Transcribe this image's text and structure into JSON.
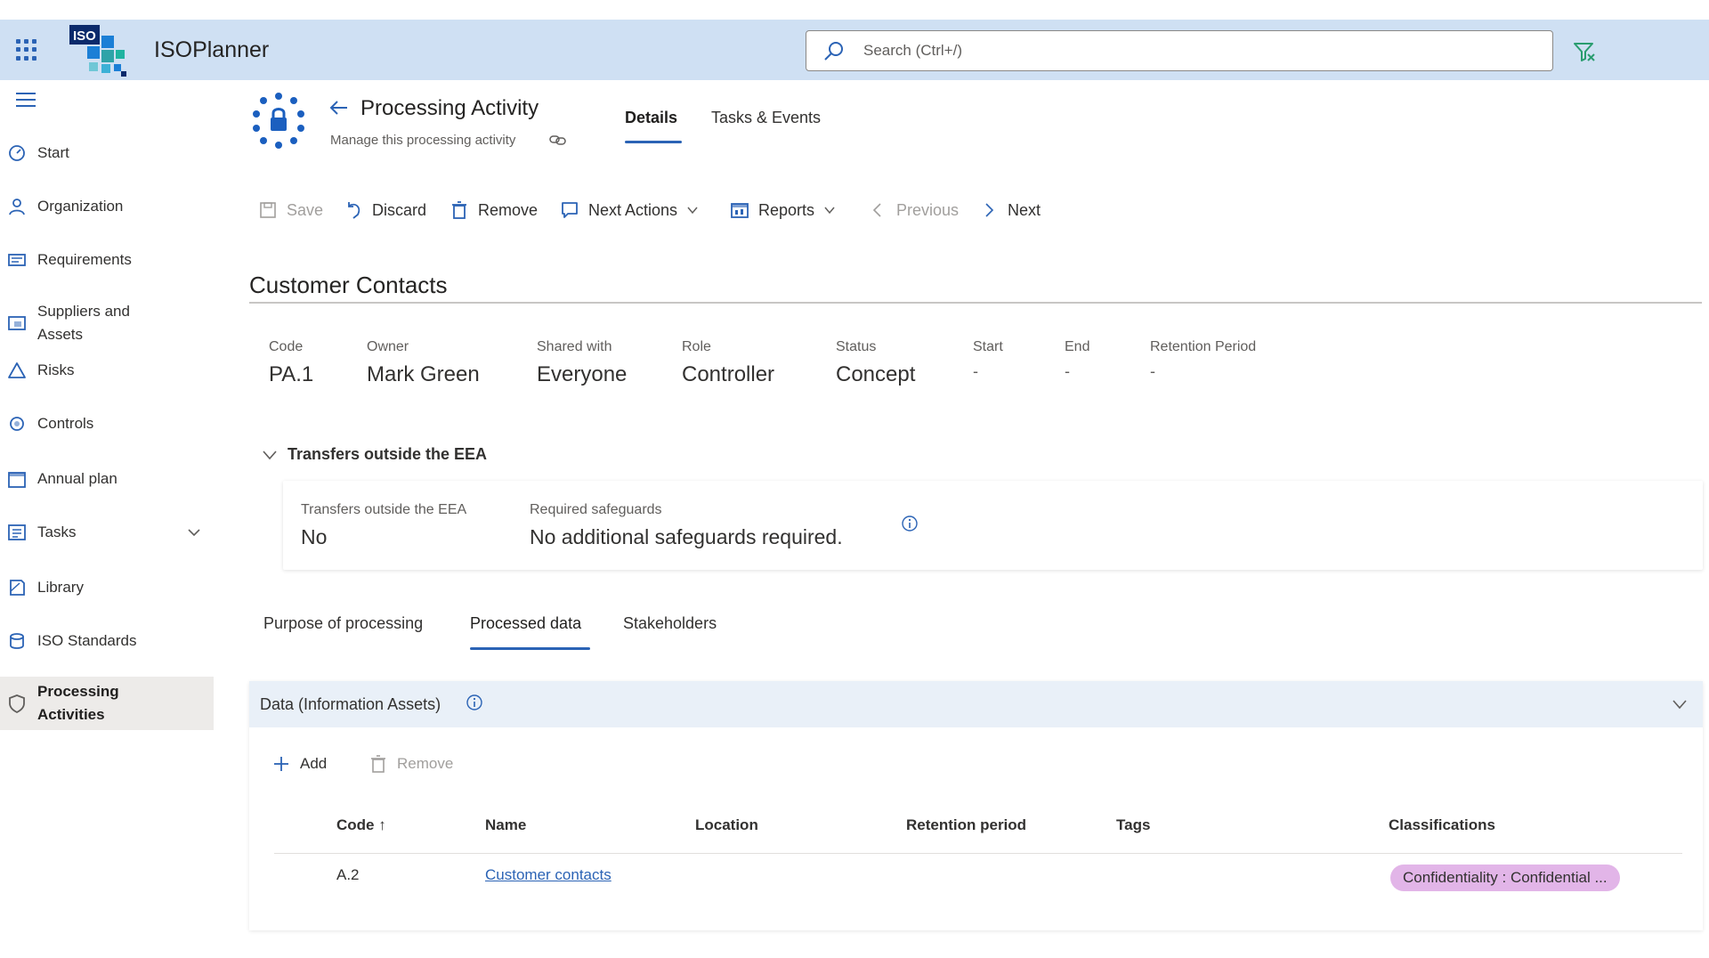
{
  "app": {
    "title": "ISOPlanner",
    "logo_text": "ISO"
  },
  "search": {
    "placeholder": "Search (Ctrl+/)"
  },
  "sidebar": {
    "items": [
      {
        "label": "Start"
      },
      {
        "label": "Organization"
      },
      {
        "label": "Requirements"
      },
      {
        "label": "Suppliers and Assets"
      },
      {
        "label": "Risks"
      },
      {
        "label": "Controls"
      },
      {
        "label": "Annual plan"
      },
      {
        "label": "Tasks"
      },
      {
        "label": "Library"
      },
      {
        "label": "ISO Standards"
      },
      {
        "label": "Processing Activities"
      }
    ],
    "active": "Processing Activities"
  },
  "header": {
    "title": "Processing Activity",
    "subtitle": "Manage this processing activity",
    "tabs": [
      {
        "label": "Details"
      },
      {
        "label": "Tasks & Events"
      }
    ],
    "active_tab": "Details"
  },
  "toolbar": {
    "save": "Save",
    "discard": "Discard",
    "remove": "Remove",
    "next_actions": "Next Actions",
    "reports": "Reports",
    "previous": "Previous",
    "next": "Next"
  },
  "record": {
    "title": "Customer Contacts",
    "fields": [
      {
        "label": "Code",
        "value": "PA.1"
      },
      {
        "label": "Owner",
        "value": "Mark Green"
      },
      {
        "label": "Shared with",
        "value": "Everyone"
      },
      {
        "label": "Role",
        "value": "Controller"
      },
      {
        "label": "Status",
        "value": "Concept"
      },
      {
        "label": "Start",
        "value": "-"
      },
      {
        "label": "End",
        "value": "-"
      },
      {
        "label": "Retention Period",
        "value": "-"
      }
    ]
  },
  "transfers": {
    "section_label": "Transfers outside the EEA",
    "fields": [
      {
        "label": "Transfers outside the EEA",
        "value": "No"
      },
      {
        "label": "Required safeguards",
        "value": "No additional safeguards required."
      }
    ]
  },
  "subtabs": {
    "items": [
      {
        "label": "Purpose of processing"
      },
      {
        "label": "Processed data"
      },
      {
        "label": "Stakeholders"
      }
    ],
    "active": "Processed data"
  },
  "data_panel": {
    "title": "Data (Information Assets)",
    "add_label": "Add",
    "remove_label": "Remove",
    "columns": [
      {
        "label": "Code ↑"
      },
      {
        "label": "Name"
      },
      {
        "label": "Location"
      },
      {
        "label": "Retention period"
      },
      {
        "label": "Tags"
      },
      {
        "label": "Classifications"
      }
    ],
    "rows": [
      {
        "code": "A.2",
        "name": "Customer contacts",
        "location": "",
        "retention": "",
        "tags": "",
        "classification": "Confidentiality : Confidential ..."
      }
    ]
  },
  "colors": {
    "accent": "#2b63b5",
    "topbar": "#cfe0f3",
    "badge": "#e2b5e8"
  }
}
